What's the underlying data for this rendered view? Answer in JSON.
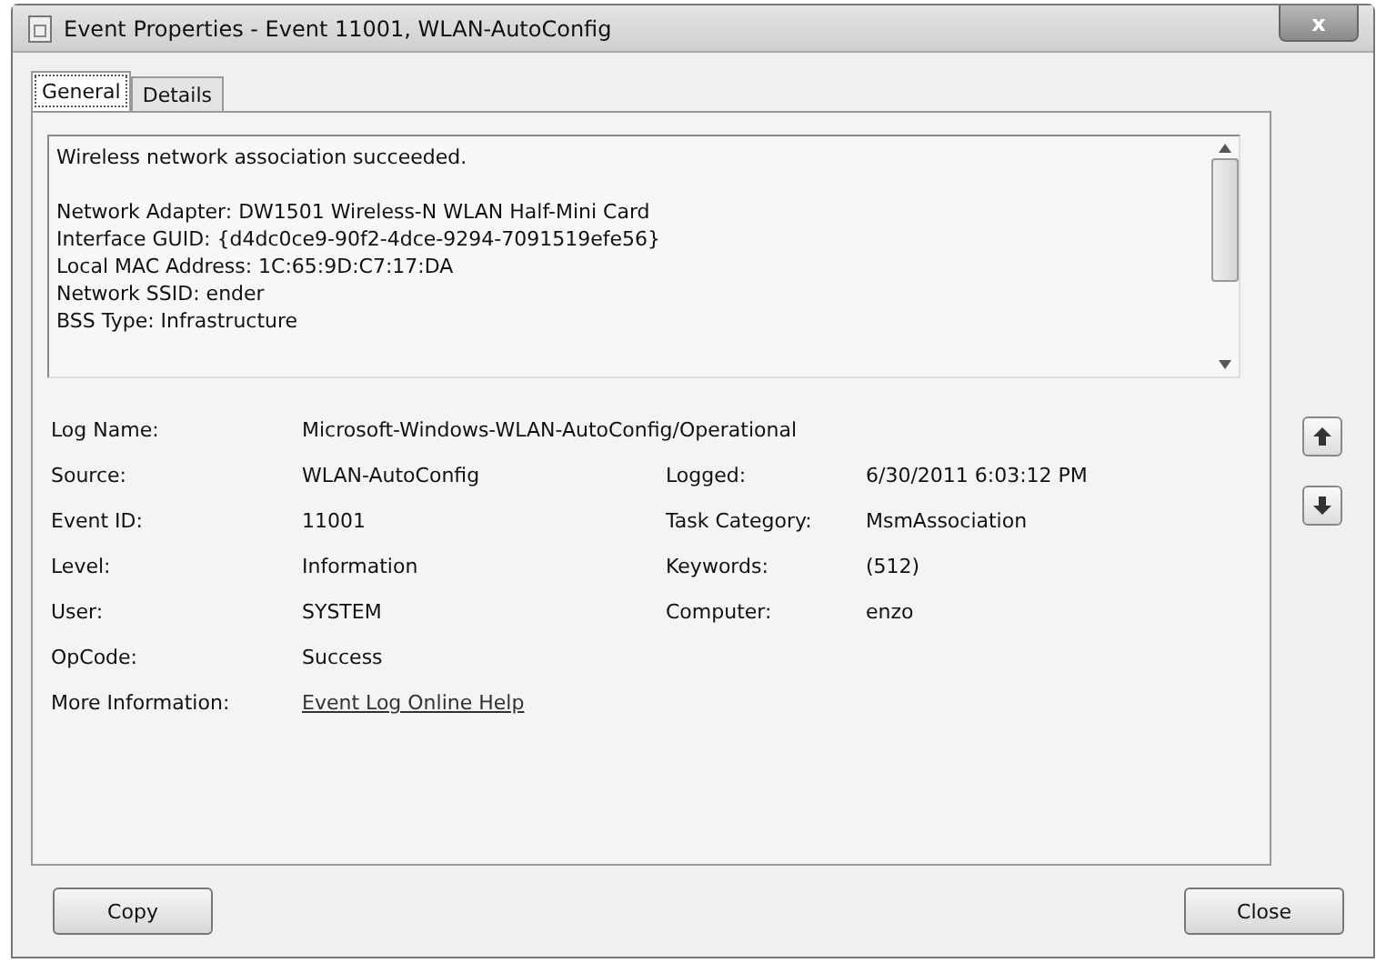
{
  "window": {
    "title": "Event Properties - Event 11001, WLAN-AutoConfig",
    "close": "x"
  },
  "tabs": [
    {
      "label": "General",
      "selected": true
    },
    {
      "label": "Details",
      "selected": false
    }
  ],
  "description": {
    "summary": "Wireless network association succeeded.",
    "details": [
      "Network Adapter: DW1501 Wireless-N WLAN Half-Mini Card",
      "Interface GUID: {d4dc0ce9-90f2-4dce-9294-7091519efe56}",
      "Local MAC Address: 1C:65:9D:C7:17:DA",
      "Network SSID: ender",
      "BSS Type: Infrastructure"
    ]
  },
  "fields": [
    [
      {
        "label": "Log Name:",
        "value": "Microsoft-Windows-WLAN-AutoConfig/Operational"
      }
    ],
    [
      {
        "label": "Source:",
        "value": "WLAN-AutoConfig"
      },
      {
        "label": "Logged:",
        "value": "6/30/2011 6:03:12 PM"
      }
    ],
    [
      {
        "label": "Event ID:",
        "value": "11001"
      },
      {
        "label": "Task Category:",
        "value": "MsmAssociation"
      }
    ],
    [
      {
        "label": "Level:",
        "value": "Information"
      },
      {
        "label": "Keywords:",
        "value": "(512)"
      }
    ],
    [
      {
        "label": "User:",
        "value": "SYSTEM"
      },
      {
        "label": "Computer:",
        "value": "enzo"
      }
    ],
    [
      {
        "label": "OpCode:",
        "value": "Success"
      }
    ],
    [
      {
        "label": "More Information:",
        "value": "Event Log Online Help",
        "kind": "link"
      }
    ]
  ],
  "buttons": [
    {
      "label": "Copy"
    },
    {
      "label": "Close"
    }
  ]
}
